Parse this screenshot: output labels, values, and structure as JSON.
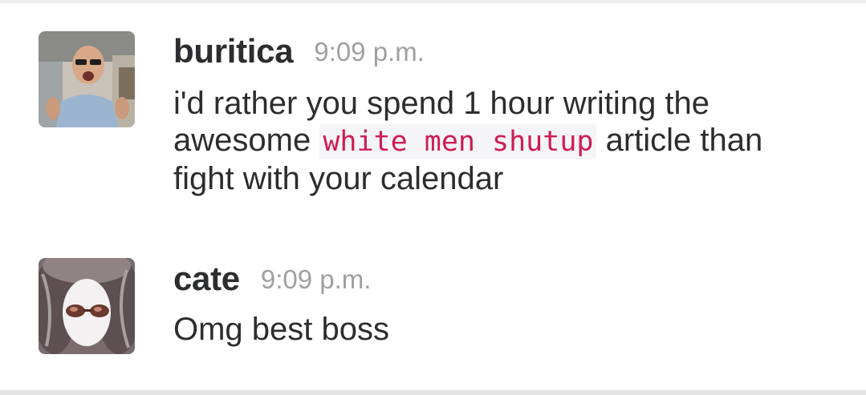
{
  "messages": [
    {
      "author": "buritica",
      "time": "9:09 p.m.",
      "text_before": "i'd rather you spend 1 hour writing the awesome ",
      "code": "white men shutup",
      "text_after": " article than fight with your calendar"
    },
    {
      "author": "cate",
      "time": "9:09 p.m.",
      "text": "Omg best boss"
    }
  ],
  "colors": {
    "author": "#2c2d30",
    "timestamp": "#a0a0a2",
    "code_text": "#d01c52",
    "code_bg": "#f5f5f7"
  }
}
